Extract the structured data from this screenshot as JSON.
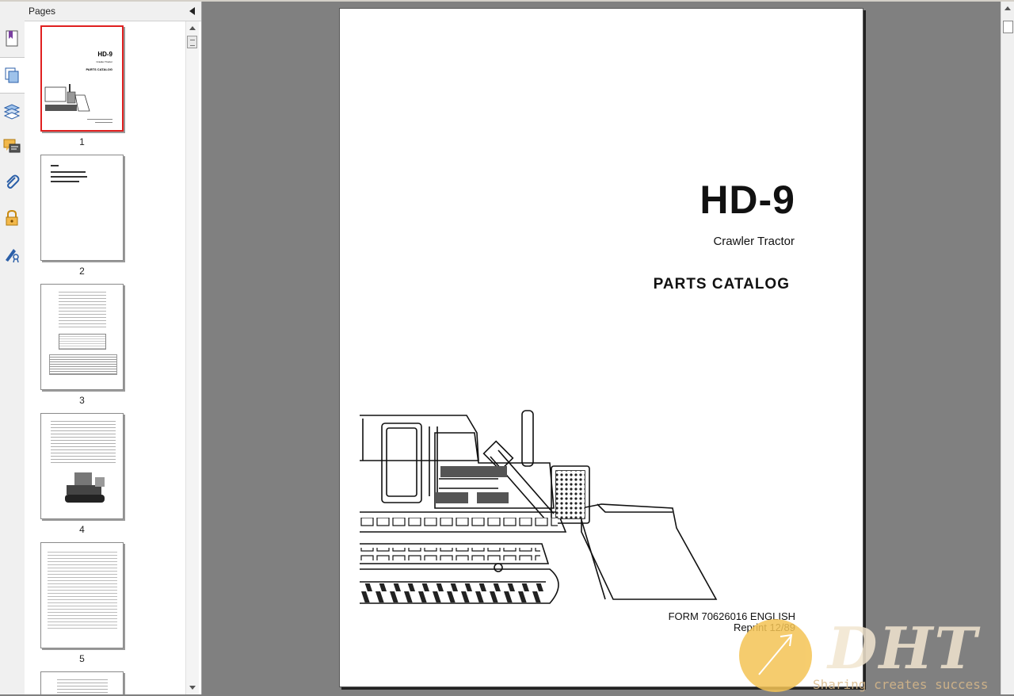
{
  "panel": {
    "title": "Pages",
    "thumbnails": [
      {
        "page": "1",
        "title": "HD-9",
        "subtitle": "Crawler Tractor",
        "catalog": "PARTS CATALOG"
      },
      {
        "page": "2"
      },
      {
        "page": "3"
      },
      {
        "page": "4"
      },
      {
        "page": "5"
      }
    ]
  },
  "rail": {
    "tools": [
      "bookmarks-icon",
      "pages-icon",
      "layers-icon",
      "comments-icon",
      "attachments-icon",
      "security-icon",
      "signatures-icon"
    ]
  },
  "document": {
    "title": "HD-9",
    "subtitle": "Crawler Tractor",
    "catalog": "PARTS CATALOG",
    "form": "FORM 70626016 ENGLISH",
    "reprint": "Reprint 12/89"
  },
  "watermark": {
    "logo": "DHT",
    "tagline": "Sharing creates success"
  },
  "colors": {
    "selected_border": "#e02020",
    "canvas": "#808080"
  }
}
